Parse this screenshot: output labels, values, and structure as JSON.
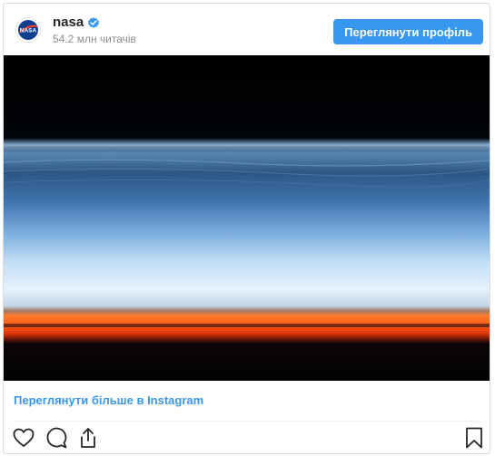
{
  "profile": {
    "username": "nasa",
    "followers": "54.2 млн читачів",
    "view_profile_label": "Переглянути профіль",
    "avatar_icon": "nasa-logo-icon",
    "verified_icon": "verified-badge-icon"
  },
  "post": {
    "more_link": "Переглянути більше в Instagram"
  },
  "actions": [
    {
      "icon": "heart-icon"
    },
    {
      "icon": "comment-icon"
    },
    {
      "icon": "share-icon"
    },
    {
      "icon": "bookmark-icon"
    }
  ],
  "colors": {
    "accent": "#3897f0",
    "username": "#262626",
    "muted": "#8e8e8e"
  }
}
